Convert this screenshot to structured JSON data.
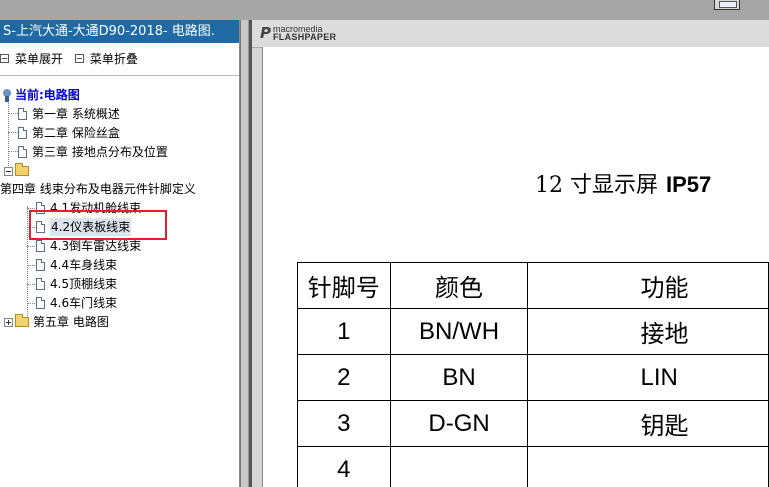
{
  "window": {
    "title": "S-上汽大通-大通D90-2018- 电路图."
  },
  "menu": {
    "expand_label": "菜单展开",
    "collapse_label": "菜单折叠"
  },
  "tree": {
    "root_label": "当前:电路图",
    "ch1": "第一章 系统概述",
    "ch2": "第二章 保险丝盒",
    "ch3": "第三章 接地点分布及位置",
    "ch4": "第四章 线束分布及电器元件针脚定义",
    "ch4_items": [
      "4.1发动机舱线束",
      "4.2仪表板线束",
      "4.3倒车雷达线束",
      "4.4车身线束",
      "4.5顶棚线束",
      "4.6车门线束"
    ],
    "ch5": "第五章 电路图"
  },
  "viewer": {
    "brand_top": "macromedia",
    "brand_bottom": "FLASHPAPER",
    "doc_title_main": "12 寸显示屏",
    "doc_title_code": "IP57",
    "table_headers": [
      "针脚号",
      "颜色",
      "功能"
    ],
    "table_rows": [
      [
        "1",
        "BN/WH",
        "接地"
      ],
      [
        "2",
        "BN",
        "LIN"
      ],
      [
        "3",
        "D-GN",
        "钥匙"
      ],
      [
        "4",
        "",
        ""
      ]
    ]
  },
  "colors": {
    "titlebar_bg": "#1f6aa5",
    "highlight_box": "#e0202a",
    "root_label": "#0000cc"
  }
}
